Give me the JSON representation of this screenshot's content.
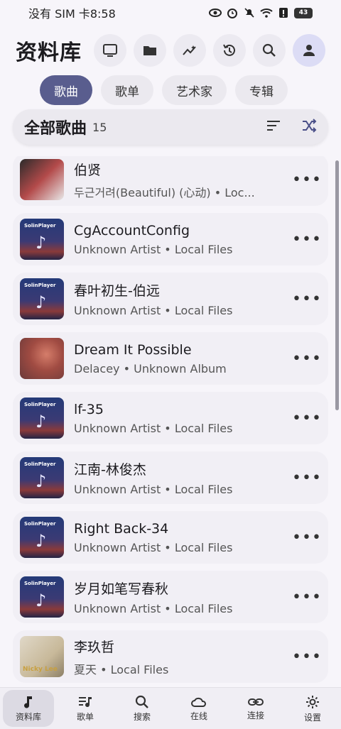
{
  "status_bar": {
    "carrier_time": "没有 SIM 卡8:58",
    "battery": "43",
    "icons": [
      "eye-icon",
      "alarm-icon",
      "mute-icon",
      "wifi-icon",
      "alert-icon",
      "battery-icon"
    ]
  },
  "header": {
    "title": "资料库",
    "actions": [
      "tv-icon",
      "folder-icon",
      "stats-icon",
      "history-icon",
      "search-icon",
      "account-icon"
    ]
  },
  "tabs": [
    {
      "label": "歌曲",
      "active": true
    },
    {
      "label": "歌单",
      "active": false
    },
    {
      "label": "艺术家",
      "active": false
    },
    {
      "label": "专辑",
      "active": false
    }
  ],
  "section": {
    "title": "全部歌曲",
    "count": "15"
  },
  "songs": [
    {
      "title": "伯贤",
      "subtitle": "두근거려(Beautiful) (心动) • Loc...",
      "cover": "exo"
    },
    {
      "title": "CgAccountConfig",
      "subtitle": "Unknown Artist • Local Files",
      "cover": "solin"
    },
    {
      "title": "春叶初生-伯远",
      "subtitle": "Unknown Artist • Local Files",
      "cover": "solin"
    },
    {
      "title": "Dream It Possible",
      "subtitle": "Delacey • Unknown Album",
      "cover": "dream"
    },
    {
      "title": "lf-35",
      "subtitle": "Unknown Artist • Local Files",
      "cover": "solin"
    },
    {
      "title": "江南-林俊杰",
      "subtitle": "Unknown Artist • Local Files",
      "cover": "solin"
    },
    {
      "title": "Right Back-34",
      "subtitle": "Unknown Artist • Local Files",
      "cover": "solin"
    },
    {
      "title": "岁月如笔写春秋",
      "subtitle": "Unknown Artist • Local Files",
      "cover": "solin"
    },
    {
      "title": "李玖哲",
      "subtitle": "夏天 • Local Files",
      "cover": "nicky"
    }
  ],
  "cover_text": {
    "solin": "SolinPlayer",
    "nicky": "Nicky Lee"
  },
  "more_label": "•••",
  "bottom_nav": [
    {
      "label": "资料库",
      "icon": "music-note-icon",
      "active": true
    },
    {
      "label": "歌单",
      "icon": "playlist-icon",
      "active": false
    },
    {
      "label": "搜索",
      "icon": "search-icon",
      "active": false
    },
    {
      "label": "在线",
      "icon": "cloud-icon",
      "active": false
    },
    {
      "label": "连接",
      "icon": "link-icon",
      "active": false
    },
    {
      "label": "设置",
      "icon": "gear-icon",
      "active": false
    }
  ],
  "colors": {
    "accent": "#595d8e",
    "background": "#f7f5fa",
    "card": "#f1eff5"
  }
}
